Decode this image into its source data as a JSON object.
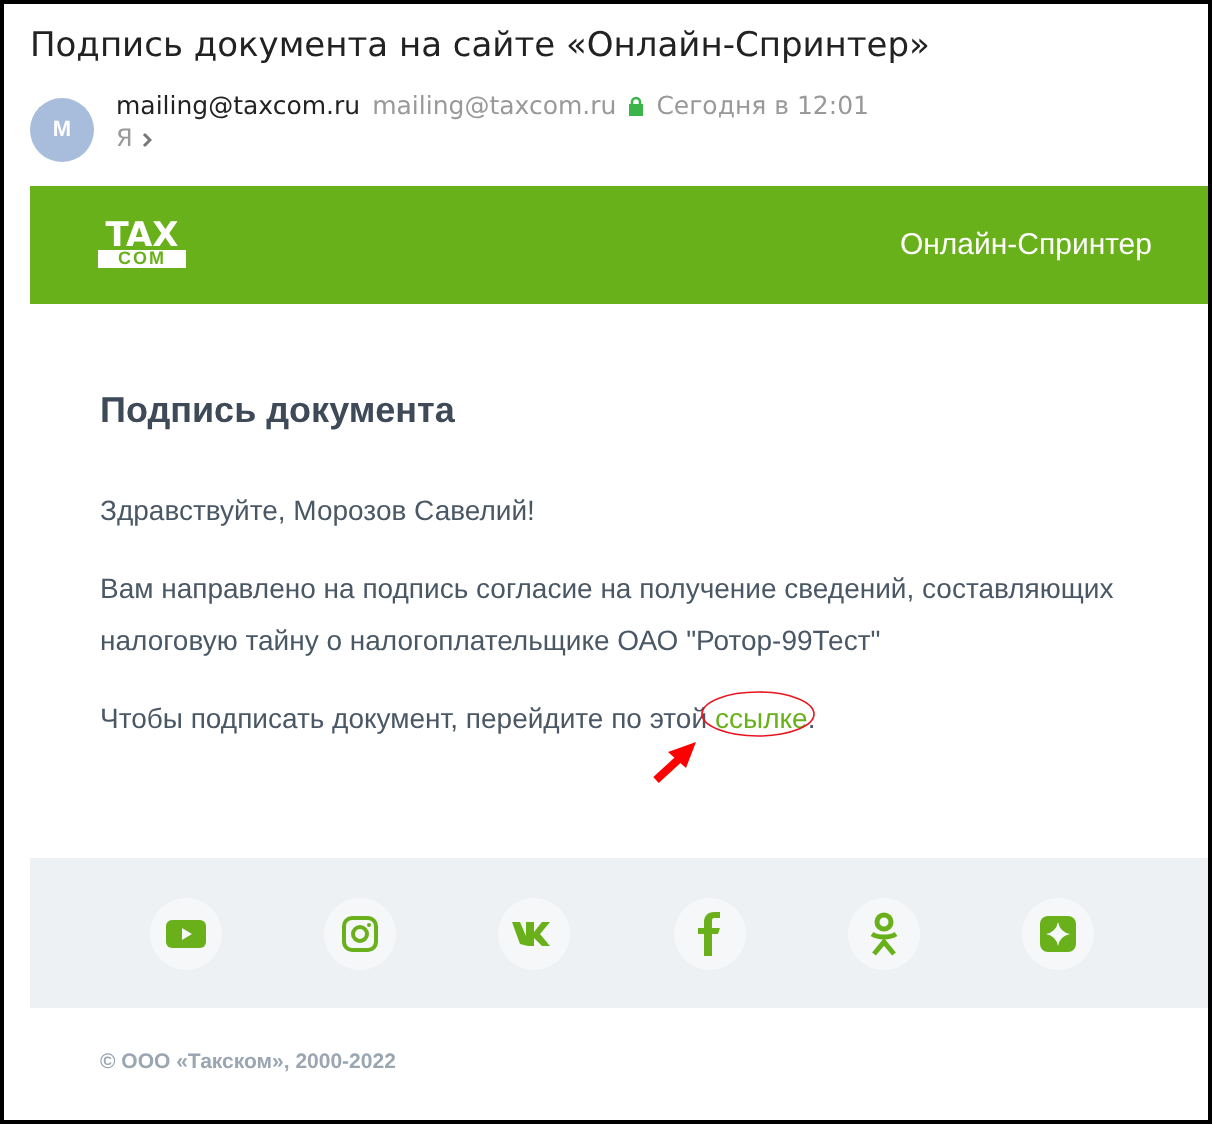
{
  "subject": "Подпись документа на сайте «Онлайн-Спринтер»",
  "sender": {
    "avatar_letter": "M",
    "name": "mailing@taxcom.ru",
    "address": "mailing@taxcom.ru",
    "time": "Сегодня в 12:01",
    "recipient": "Я"
  },
  "banner": {
    "logo_top": "TAX",
    "logo_bottom": "COM",
    "service": "Онлайн-Спринтер"
  },
  "body": {
    "heading": "Подпись документа",
    "greeting": "Здравствуйте, Морозов Савелий!",
    "paragraph": "Вам направлено на подпись согласие на получение сведений, составляющих налоговую тайну о налогоплательщике ОАО \"Ротор-99Тест\"",
    "link_intro": "Чтобы подписать документ, перейдите по этой",
    "link": "ссылке",
    "link_end": "."
  },
  "social": [
    {
      "kind": "youtube"
    },
    {
      "kind": "instagram"
    },
    {
      "kind": "vk"
    },
    {
      "kind": "facebook"
    },
    {
      "kind": "ok"
    },
    {
      "kind": "star"
    }
  ],
  "copyright": "© ООО «Такском», 2000-2022"
}
